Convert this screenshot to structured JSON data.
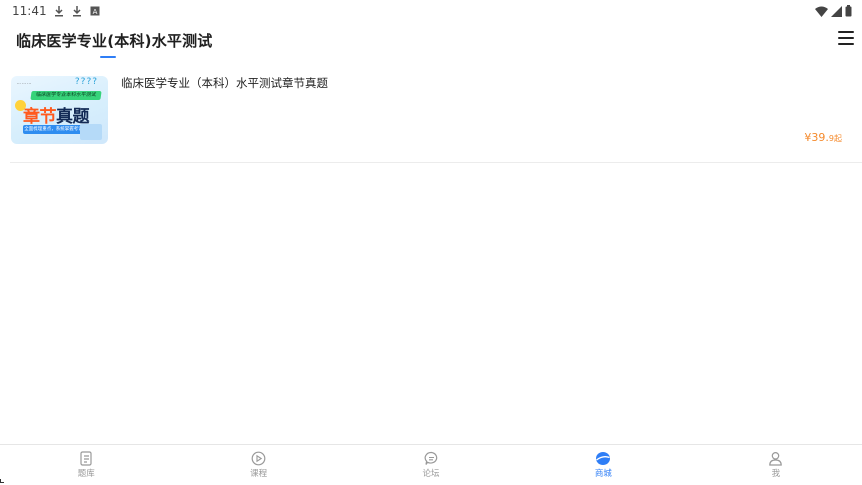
{
  "status_bar": {
    "time": "11:41",
    "left_icons": [
      "download-icon",
      "download-icon",
      "font-icon"
    ],
    "right_icons": [
      "wifi-icon",
      "cellular-icon",
      "battery-icon"
    ]
  },
  "header": {
    "title": "临床医学专业(本科)水平测试",
    "menu_icon": "menu-icon",
    "accent_color": "#2f7ef6"
  },
  "products": [
    {
      "name": "临床医学专业（本科）水平测试章节真题",
      "price_main": "¥39.",
      "price_decimal": "9起",
      "price_color": "#f58a2c",
      "thumbnail": {
        "tag": "临床医学专业本科水平测试",
        "headline_a": "章节",
        "headline_b": "真题",
        "banner": "全面梳理重点，系统掌握考试大纲"
      }
    }
  ],
  "tabbar": {
    "active_index": 3,
    "items": [
      {
        "label": "题库",
        "icon": "question-bank-icon"
      },
      {
        "label": "课程",
        "icon": "play-circle-icon"
      },
      {
        "label": "论坛",
        "icon": "chat-bubble-icon"
      },
      {
        "label": "商城",
        "icon": "shop-icon"
      },
      {
        "label": "我",
        "icon": "user-icon"
      }
    ]
  }
}
